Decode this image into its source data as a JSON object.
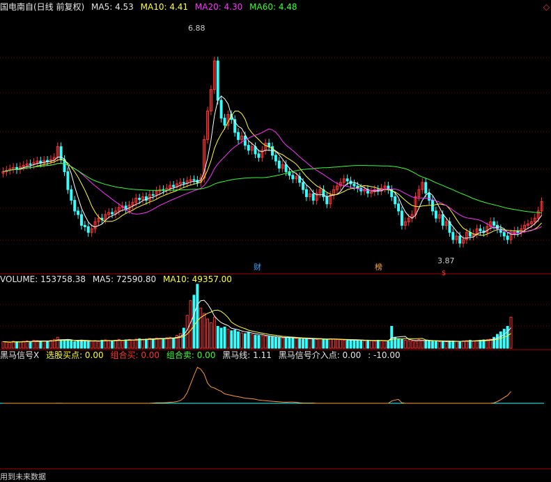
{
  "header": {
    "title": "国电南自(日线 前复权)",
    "ma5": "MA5: 4.53",
    "ma10": "MA10: 4.41",
    "ma20": "MA20: 4.30",
    "ma60": "MA60: 4.48",
    "diamond": "◇"
  },
  "volume_header": {
    "label": "VOLUME: 153758.38",
    "ma5": "MA5: 72590.80",
    "ma10": "MA10: 49357.00"
  },
  "indicator_header": {
    "name": "黑马信号X",
    "buy_point": "选股买点: 0.00",
    "combo_buy": "组合买: 0.00",
    "combo_sell": "组合卖: 0.00",
    "horse_line": "黑马线: 1.11",
    "entry_point": "黑马信号介入点: 0.00",
    "extra": ": -10.00"
  },
  "footer": {
    "text": "用到未来数据"
  },
  "colors": {
    "up": "#ff3333",
    "down": "#33ffff",
    "ma5": "#ffffff",
    "ma10": "#ffff33",
    "ma20": "#ff33ff",
    "ma60": "#33ff33",
    "grid": "#8b0000",
    "divider": "#aa0000"
  },
  "chart_data": [
    {
      "type": "candlestick",
      "title": "国电南自(日线 前复权)",
      "ylim": [
        3.6,
        7.1
      ],
      "annotations": {
        "high_label": "6.88",
        "low_label": "3.87",
        "event_label_1": "财",
        "event_label_2": "榜",
        "event_label_3": "$"
      },
      "close": [
        4.95,
        4.97,
        4.99,
        5.01,
        4.98,
        5.02,
        5.04,
        5.06,
        5.05,
        5.08,
        5.1,
        5.07,
        5.11,
        5.09,
        5.12,
        5.15,
        5.3,
        5.12,
        4.95,
        4.7,
        4.55,
        4.4,
        4.35,
        4.2,
        4.18,
        4.1,
        4.15,
        4.25,
        4.3,
        4.28,
        4.35,
        4.38,
        4.36,
        4.4,
        4.45,
        4.47,
        4.42,
        4.48,
        4.52,
        4.58,
        4.56,
        4.6,
        4.55,
        4.63,
        4.62,
        4.68,
        4.7,
        4.69,
        4.72,
        4.76,
        4.74,
        4.78,
        4.8,
        4.79,
        4.82,
        4.84,
        4.83,
        4.8,
        4.86,
        5.4,
        5.8,
        6.1,
        6.5,
        5.95,
        5.7,
        5.6,
        5.75,
        5.68,
        5.5,
        5.4,
        5.45,
        5.32,
        5.25,
        5.3,
        5.2,
        5.15,
        5.25,
        5.35,
        5.3,
        5.18,
        5.1,
        5.0,
        5.05,
        4.95,
        4.9,
        4.85,
        4.88,
        4.8,
        4.7,
        4.6,
        4.64,
        4.55,
        4.65,
        4.7,
        4.6,
        4.5,
        4.62,
        4.7,
        4.75,
        4.8,
        4.85,
        4.82,
        4.78,
        4.75,
        4.72,
        4.68,
        4.7,
        4.65,
        4.67,
        4.7,
        4.68,
        4.72,
        4.75,
        4.7,
        4.6,
        4.5,
        4.4,
        4.2,
        4.25,
        4.3,
        4.35,
        4.6,
        4.7,
        4.8,
        4.65,
        4.55,
        4.4,
        4.3,
        4.35,
        4.2,
        4.25,
        4.1,
        4.0,
        4.05,
        3.95,
        4.0,
        4.1,
        4.05,
        4.08,
        4.15,
        4.12,
        4.1,
        4.18,
        4.25,
        4.2,
        4.15,
        4.1,
        4.05,
        4.0,
        4.08,
        4.12,
        4.1,
        4.15,
        4.2,
        4.22,
        4.25,
        4.3,
        4.4,
        4.53
      ]
    },
    {
      "type": "bar",
      "title": "VOLUME",
      "values": [
        18,
        17,
        16,
        19,
        18,
        17,
        19,
        20,
        18,
        22,
        21,
        19,
        20,
        18,
        22,
        24,
        30,
        22,
        20,
        24,
        21,
        18,
        20,
        22,
        18,
        19,
        20,
        21,
        19,
        22,
        23,
        21,
        20,
        22,
        24,
        21,
        23,
        24,
        22,
        25,
        26,
        24,
        25,
        27,
        26,
        28,
        27,
        26,
        29,
        30,
        28,
        35,
        40,
        55,
        90,
        130,
        145,
        175,
        110,
        95,
        80,
        70,
        85,
        60,
        55,
        58,
        52,
        48,
        50,
        45,
        42,
        40,
        44,
        38,
        36,
        35,
        34,
        33,
        32,
        31,
        30,
        29,
        28,
        29,
        30,
        28,
        27,
        26,
        25,
        27,
        26,
        25,
        24,
        26,
        25,
        24,
        26,
        25,
        24,
        23,
        22,
        21,
        22,
        23,
        22,
        21,
        20,
        22,
        21,
        20,
        22,
        21,
        20,
        19,
        60,
        30,
        26,
        24,
        22,
        21,
        20,
        19,
        24,
        22,
        21,
        20,
        19,
        20,
        18,
        19,
        18,
        19,
        20,
        19,
        18,
        20,
        21,
        22,
        20,
        21,
        22,
        23,
        24,
        25,
        30,
        38,
        45,
        52,
        60,
        85
      ]
    }
  ]
}
